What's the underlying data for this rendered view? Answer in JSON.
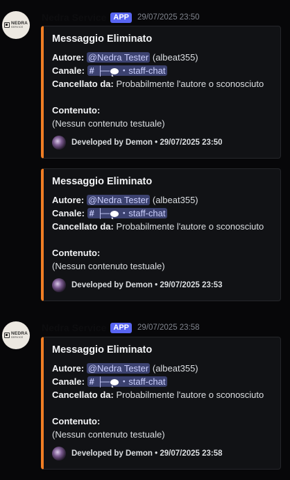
{
  "messages": [
    {
      "author": "Nedra Service",
      "badge": "APP",
      "timestamp": "29/07/2025 23:50",
      "avatar_logo": {
        "name": "NEDRA",
        "sub": "SERVICE"
      },
      "embeds": [
        {
          "title": "Messaggio Eliminato",
          "author_label": "Autore:",
          "author_mention": "@Nedra Tester",
          "author_extra": "(albeat355)",
          "channel_label": "Canale:",
          "channel_prefix": "├─",
          "channel_suffix": "・staff-chat",
          "deleted_by_label": "Cancellato da:",
          "deleted_by_value": "Probabilmente l'autore o sconosciuto",
          "content_label": "Contenuto:",
          "content_value": "(Nessun contenuto testuale)",
          "footer": "Developed by Demon • 29/07/2025 23:50"
        },
        {
          "title": "Messaggio Eliminato",
          "author_label": "Autore:",
          "author_mention": "@Nedra Tester",
          "author_extra": "(albeat355)",
          "channel_label": "Canale:",
          "channel_prefix": "├─",
          "channel_suffix": "・staff-chat",
          "deleted_by_label": "Cancellato da:",
          "deleted_by_value": "Probabilmente l'autore o sconosciuto",
          "content_label": "Contenuto:",
          "content_value": "(Nessun contenuto testuale)",
          "footer": "Developed by Demon • 29/07/2025 23:53"
        }
      ]
    },
    {
      "author": "Nedra Service",
      "badge": "APP",
      "timestamp": "29/07/2025 23:58",
      "avatar_logo": {
        "name": "NEDRA",
        "sub": "SERVICE"
      },
      "embeds": [
        {
          "title": "Messaggio Eliminato",
          "author_label": "Autore:",
          "author_mention": "@Nedra Tester",
          "author_extra": "(albeat355)",
          "channel_label": "Canale:",
          "channel_prefix": "├─",
          "channel_suffix": "・staff-chat",
          "deleted_by_label": "Cancellato da:",
          "deleted_by_value": "Probabilmente l'autore o sconosciuto",
          "content_label": "Contenuto:",
          "content_value": "(Nessun contenuto testuale)",
          "footer": "Developed by Demon • 29/07/2025 23:58"
        }
      ]
    }
  ],
  "colors": {
    "embed_accent": "#f07e24",
    "app_badge": "#5865f2",
    "mention_bg": "#3c4270",
    "background": "#070709"
  }
}
